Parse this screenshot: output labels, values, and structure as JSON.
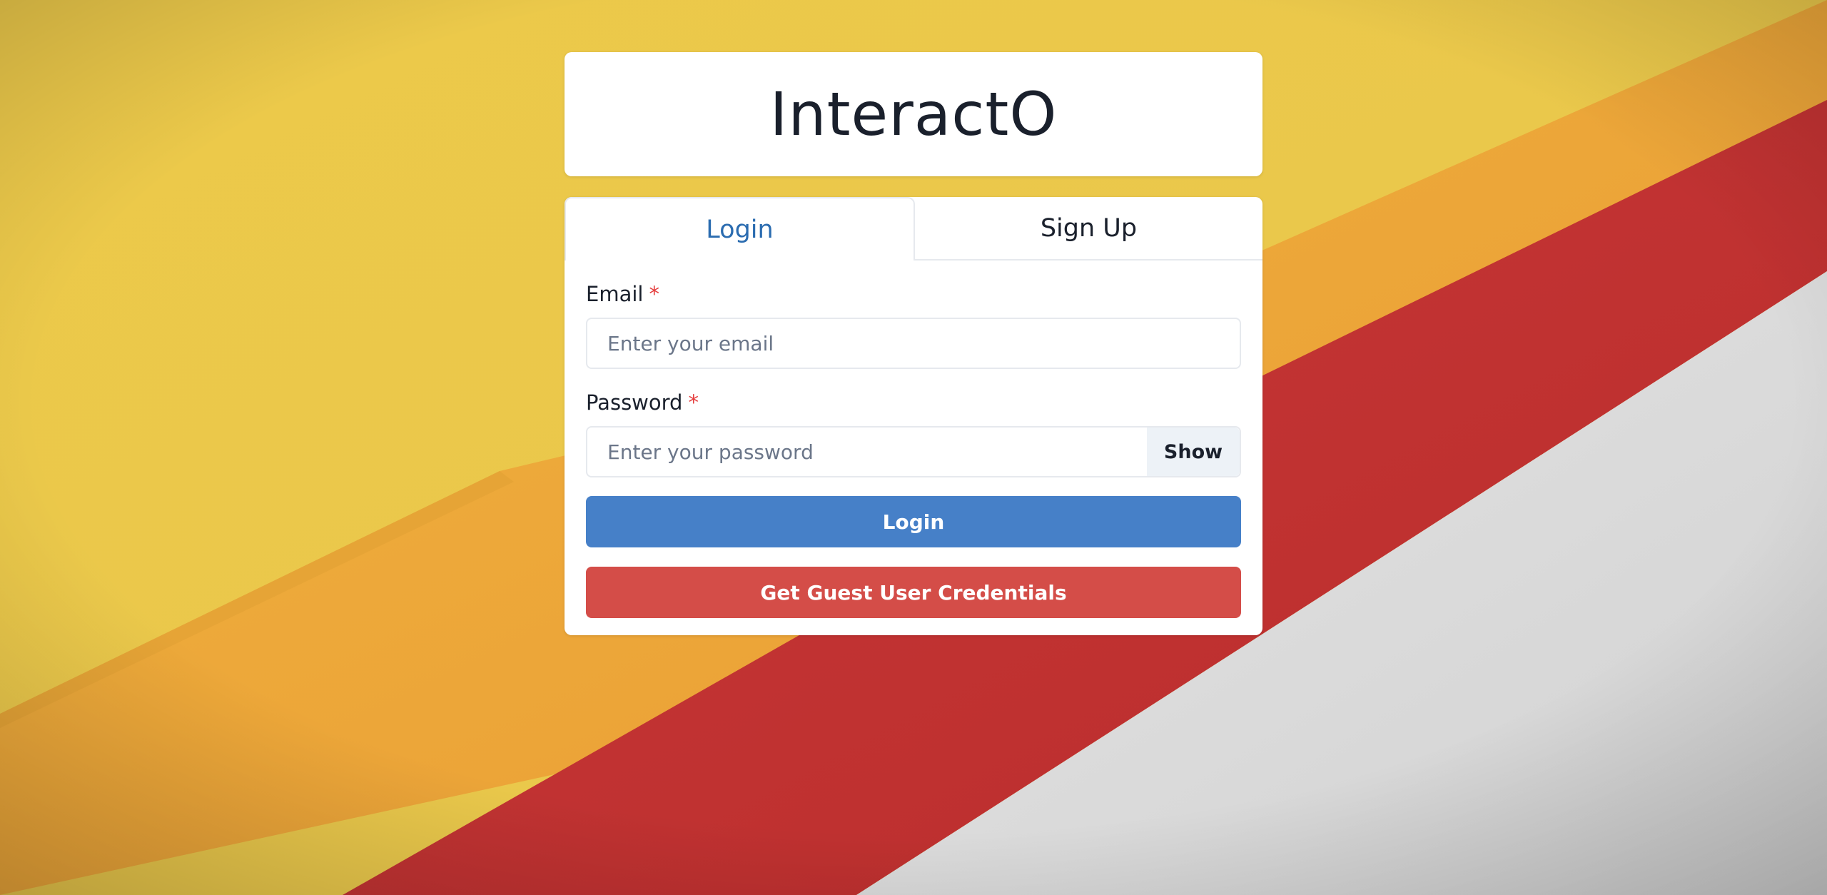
{
  "app": {
    "title": "InteractO"
  },
  "tabs": [
    {
      "label": "Login",
      "active": true
    },
    {
      "label": "Sign Up",
      "active": false
    }
  ],
  "login_form": {
    "email": {
      "label": "Email",
      "required_marker": "*",
      "placeholder": "Enter your email",
      "value": ""
    },
    "password": {
      "label": "Password",
      "required_marker": "*",
      "placeholder": "Enter your password",
      "value": "",
      "toggle_label": "Show"
    },
    "submit_label": "Login",
    "guest_label": "Get Guest User Credentials"
  },
  "colors": {
    "background_yellow": "#e9c94b",
    "background_orange": "#eaa53a",
    "background_red": "#c83532",
    "background_white": "#dcdcdc",
    "accent_blue": "#4680c8",
    "active_tab_text": "#2b6cb0",
    "guest_red": "#d44d48",
    "required_star": "#e53e3e"
  }
}
